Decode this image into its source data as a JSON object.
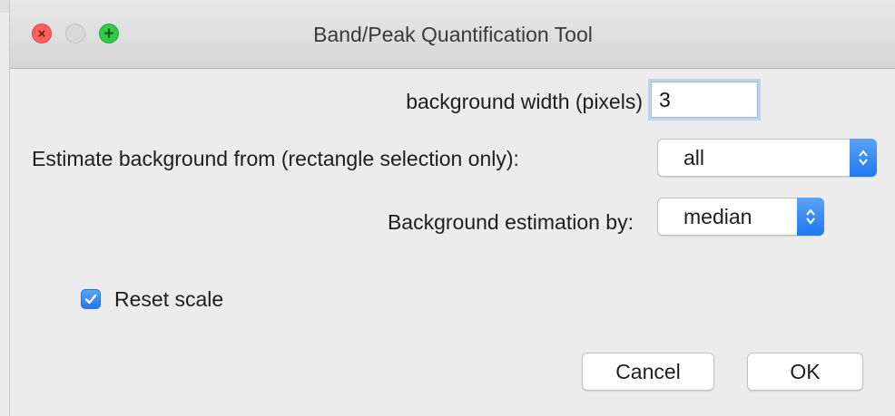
{
  "window": {
    "title": "Band/Peak Quantification Tool"
  },
  "form": {
    "background_width_label": "background width (pixels)",
    "background_width_value": "3",
    "estimate_from_label": "Estimate background from (rectangle selection only):",
    "estimate_from_selected": "all",
    "estimation_by_label": "Background estimation by:",
    "estimation_by_selected": "median",
    "reset_scale_label": "Reset scale",
    "reset_scale_checked": true
  },
  "buttons": {
    "cancel_label": "Cancel",
    "ok_label": "OK"
  },
  "icons": {
    "close": "close-icon",
    "minimize": "minimize-icon",
    "zoom": "zoom-icon",
    "popup_arrows": "chevron-up-down-icon",
    "checkmark": "checkmark-icon"
  },
  "colors": {
    "accent": "#1f79ef",
    "close": "#fc605c",
    "zoom": "#34c84a"
  }
}
